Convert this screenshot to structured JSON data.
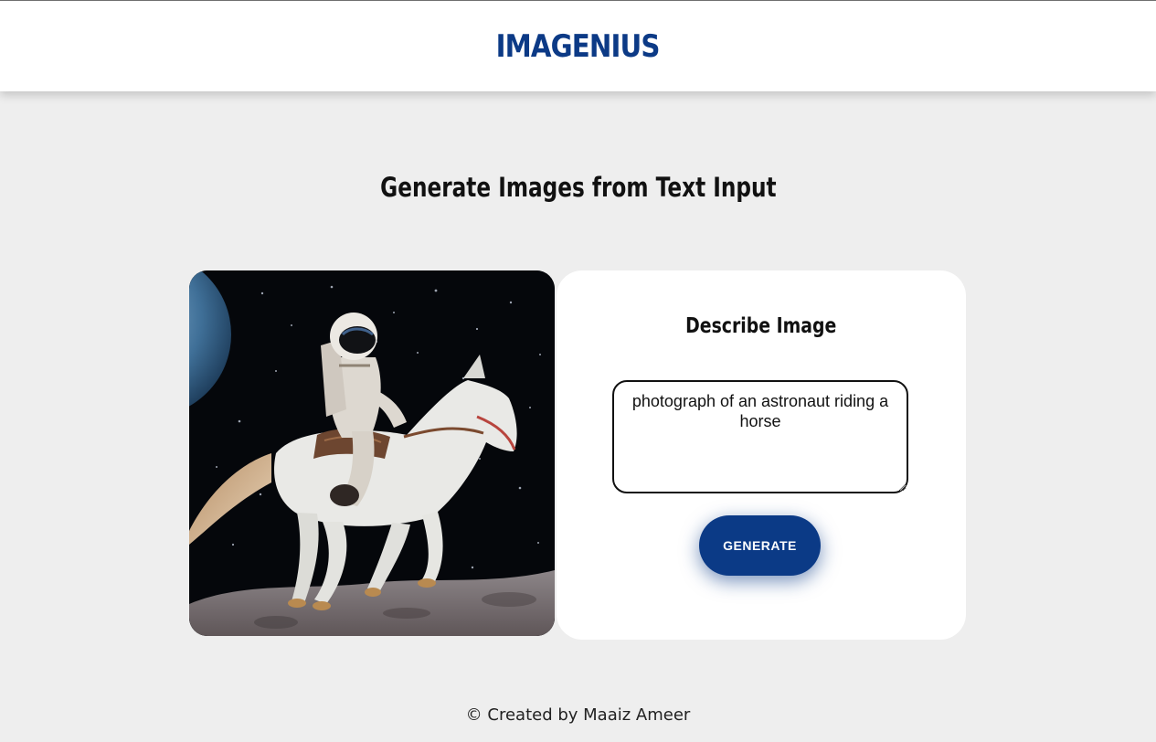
{
  "header": {
    "logo_text": "IMAGENIUS",
    "brand_color": "#0c3a86"
  },
  "main": {
    "title": "Generate Images from Text Input",
    "generated_image": {
      "content": "astronaut riding a white horse on the moon surface with a starry sky and planet edge"
    },
    "panel": {
      "title": "Describe Image",
      "prompt_value": "photograph of an astronaut riding a horse",
      "generate_label": "GENERATE",
      "button_color": "#0b3a86"
    }
  },
  "footer": {
    "text": "© Created by Maaiz Ameer"
  }
}
